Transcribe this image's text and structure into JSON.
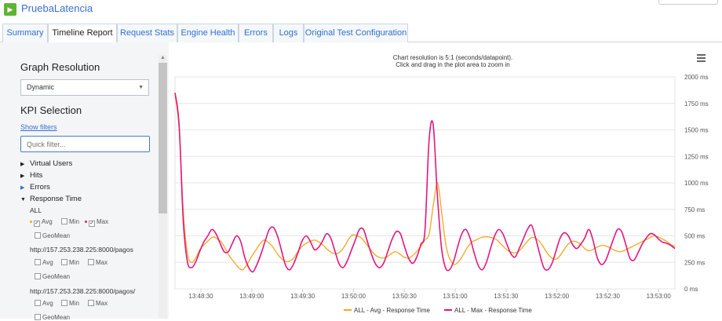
{
  "app": {
    "title": "PruebaLatencia",
    "logo_glyph": "▶"
  },
  "tabs": [
    {
      "label": "Summary",
      "active": false
    },
    {
      "label": "Timeline Report",
      "active": true
    },
    {
      "label": "Request Stats",
      "active": false
    },
    {
      "label": "Engine Health",
      "active": false
    },
    {
      "label": "Errors",
      "active": false
    },
    {
      "label": "Logs",
      "active": false
    },
    {
      "label": "Original Test Configuration",
      "active": false
    }
  ],
  "sidebar": {
    "graph_resolution_heading": "Graph Resolution",
    "resolution_value": "Dynamic",
    "kpi_heading": "KPI Selection",
    "show_filters": "Show filters",
    "quick_filter_placeholder": "Quick filter...",
    "tree": {
      "virtual_users": "Virtual Users",
      "hits": "Hits",
      "errors": "Errors",
      "response_time": "Response Time",
      "all_label": "ALL",
      "avg": "Avg",
      "min": "Min",
      "max": "Max",
      "geomean": "GeoMean",
      "url1": "http://157.253.238.225:8000/pagos",
      "url2": "http://157.253.238.225:8000/pagos/"
    }
  },
  "chart": {
    "caption_line1": "Chart resolution is 5:1 (seconds/datapoint).",
    "caption_line2": "Click and drag in the plot area to zoom in",
    "menu_icon": "hamburger-icon"
  },
  "chart_data": {
    "type": "line",
    "x_ticks": [
      "13:48:30",
      "13:49:00",
      "13:49:30",
      "13:50:00",
      "13:50:30",
      "13:51:00",
      "13:51:30",
      "13:52:00",
      "13:52:30",
      "13:53:00"
    ],
    "y_ticks": [
      "0 ms",
      "250 ms",
      "500 ms",
      "750 ms",
      "1000 ms",
      "1250 ms",
      "1500 ms",
      "1750 ms",
      "2000 ms"
    ],
    "ylim": [
      0,
      2000
    ],
    "grid": true,
    "legend_position": "bottom",
    "series": [
      {
        "name": "ALL - Avg - Response Time",
        "color": "#f5a623",
        "values": [
          1840,
          1500,
          700,
          320,
          250,
          300,
          380,
          420,
          460,
          490,
          470,
          440,
          370,
          300,
          250,
          200,
          180,
          230,
          300,
          360,
          420,
          460,
          440,
          400,
          340,
          290,
          260,
          260,
          290,
          350,
          400,
          430,
          450,
          460,
          440,
          410,
          370,
          340,
          330,
          350,
          400,
          470,
          510,
          500,
          480,
          430,
          380,
          330,
          300,
          290,
          300,
          330,
          350,
          330,
          300,
          290,
          310,
          350,
          400,
          460,
          520,
          800,
          1000,
          700,
          400,
          270,
          230,
          260,
          320,
          390,
          440,
          460,
          480,
          490,
          490,
          480,
          460,
          420,
          380,
          350,
          340,
          350,
          390,
          440,
          480,
          480,
          450,
          390,
          330,
          290,
          280,
          320,
          380,
          430,
          450,
          440,
          410,
          370,
          360,
          380,
          400,
          410,
          400,
          380,
          360,
          350,
          360,
          380,
          400,
          420,
          440,
          460,
          480,
          500,
          490,
          470,
          450,
          420,
          400
        ]
      },
      {
        "name": "ALL - Max - Response Time",
        "color": "#e6167d",
        "values": [
          1850,
          1550,
          650,
          260,
          200,
          250,
          350,
          440,
          500,
          560,
          520,
          430,
          350,
          350,
          430,
          500,
          450,
          300,
          200,
          160,
          230,
          330,
          450,
          560,
          580,
          500,
          360,
          220,
          180,
          240,
          340,
          450,
          500,
          450,
          370,
          390,
          450,
          520,
          480,
          360,
          240,
          200,
          260,
          360,
          460,
          560,
          560,
          440,
          320,
          230,
          200,
          250,
          360,
          470,
          540,
          520,
          400,
          290,
          240,
          300,
          420,
          550,
          1400,
          1550,
          900,
          400,
          200,
          180,
          260,
          400,
          520,
          560,
          480,
          340,
          220,
          180,
          250,
          380,
          500,
          560,
          520,
          420,
          330,
          300,
          380,
          470,
          560,
          600,
          480,
          330,
          200,
          180,
          240,
          360,
          480,
          530,
          500,
          420,
          380,
          420,
          480,
          560,
          460,
          300,
          230,
          260,
          360,
          470,
          560,
          540,
          420,
          290,
          270,
          340,
          420,
          480,
          520,
          510,
          470,
          440,
          430,
          410,
          380
        ]
      }
    ]
  }
}
